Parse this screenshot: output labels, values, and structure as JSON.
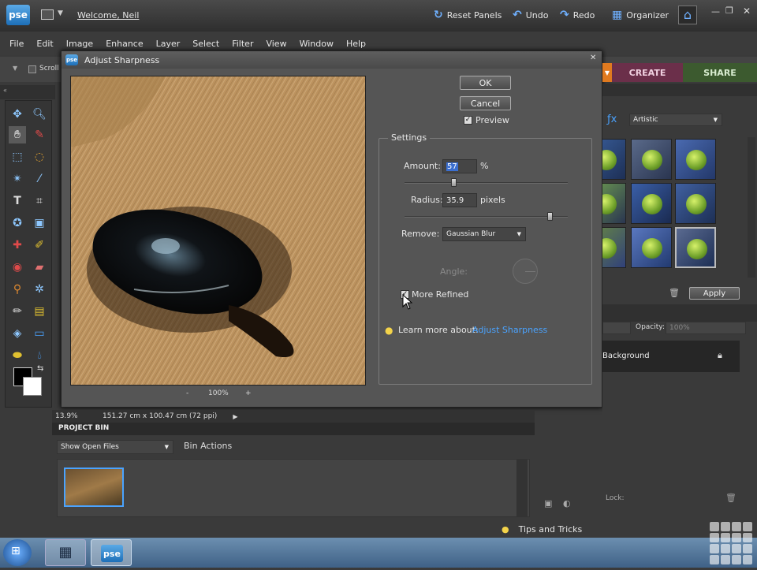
{
  "app": {
    "logo": "pse",
    "welcome": "Welcome, Neil",
    "reset_panels": "Reset Panels",
    "undo": "Undo",
    "redo": "Redo",
    "organizer": "Organizer"
  },
  "menu": [
    "File",
    "Edit",
    "Image",
    "Enhance",
    "Layer",
    "Select",
    "Filter",
    "View",
    "Window",
    "Help"
  ],
  "options_bar": {
    "scroll_label": "Scroll"
  },
  "tabs": {
    "create": "CREATE",
    "share": "SHARE"
  },
  "dialog": {
    "title": "Adjust Sharpness",
    "ok": "OK",
    "cancel": "Cancel",
    "preview_label": "Preview",
    "preview_checked": true,
    "settings_title": "Settings",
    "amount_label": "Amount:",
    "amount_value": "57",
    "amount_unit": "%",
    "amount_fraction": 0.3,
    "radius_label": "Radius:",
    "radius_value": "35.9",
    "radius_unit": "pixels",
    "radius_fraction": 0.89,
    "remove_label": "Remove:",
    "remove_value": "Gaussian Blur",
    "angle_label": "Angle:",
    "more_refined_label": "More Refined",
    "more_refined_checked": true,
    "learn_more": "Learn more about:",
    "learn_more_link": "Adjust Sharpness",
    "zoom_minus": "-",
    "zoom_value": "100%",
    "zoom_plus": "+"
  },
  "effects": {
    "filter_select": "Artistic",
    "apply": "Apply"
  },
  "layers": {
    "opacity_label": "Opacity:",
    "opacity_value": "100%",
    "layer_name": "Background",
    "lock_label": "Lock:"
  },
  "status": {
    "zoom": "13.9%",
    "doc_size": "151.27 cm x 100.47 cm (72 ppi)"
  },
  "project_bin": {
    "title": "PROJECT BIN",
    "show_select": "Show Open Files",
    "bin_actions": "Bin Actions"
  },
  "tips": "Tips and Tricks",
  "taskbar": {
    "pse": "pse"
  },
  "colors": {
    "accent_blue": "#4aa3ff",
    "create_tab": "#6b2f4a",
    "share_tab": "#3c5a2f",
    "orange": "#e07a1f"
  }
}
